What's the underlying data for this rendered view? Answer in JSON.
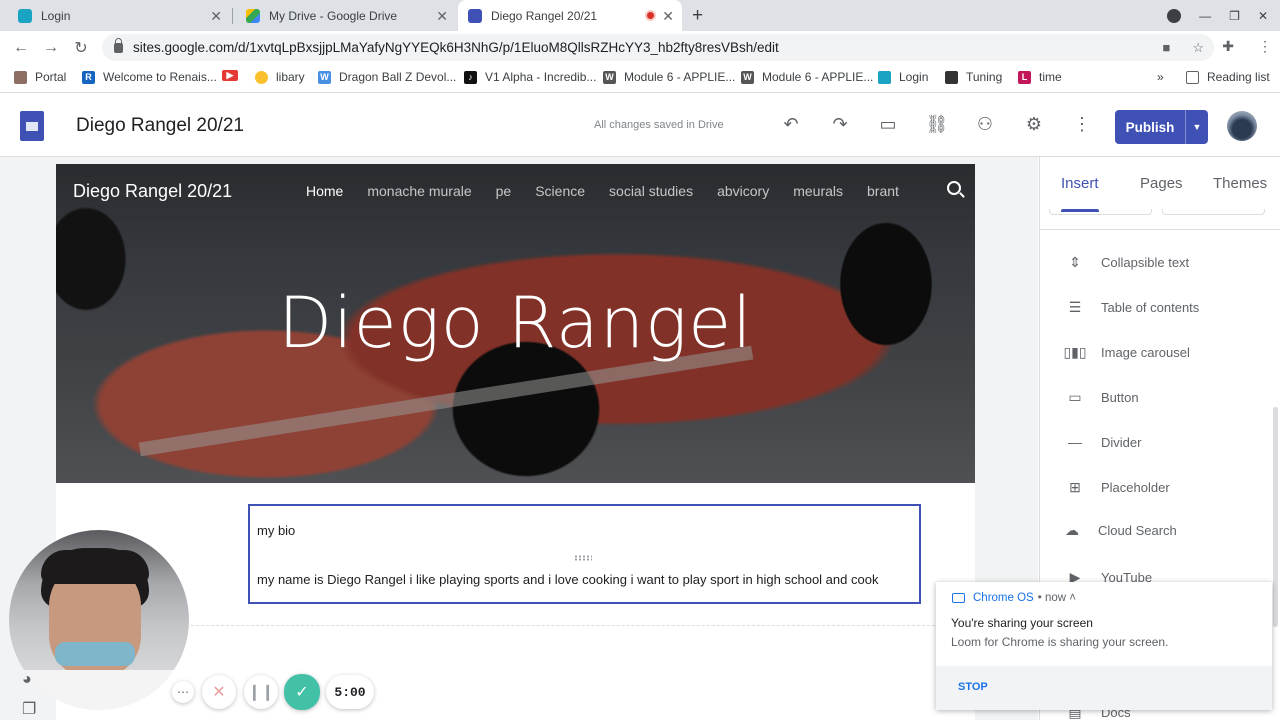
{
  "browser": {
    "tabs": [
      {
        "title": "Login",
        "color": "#1aa3c2"
      },
      {
        "title": "My Drive - Google Drive",
        "color": "#34a853"
      },
      {
        "title": "Diego Rangel 20/21",
        "color": "#3f51b5"
      }
    ],
    "url": "sites.google.com/d/1xvtqLpBxsjjpLMaYafyNgYYEQk6H3NhG/p/1EluoM8QllsRZHcYY3_hb2fty8resVBsh/edit",
    "bookmarks": [
      {
        "label": "Portal",
        "color": "#8d6e63"
      },
      {
        "label": "Welcome to Renais...",
        "color": "#1565c0"
      },
      {
        "label": "",
        "color": "#e53935"
      },
      {
        "label": "libary",
        "color": "#fbc02d"
      },
      {
        "label": "Dragon Ball Z Devol...",
        "color": "#4a90e2"
      },
      {
        "label": "V1 Alpha - Incredib...",
        "color": "#111111"
      },
      {
        "label": "Module 6 - APPLIE...",
        "color": "#555555"
      },
      {
        "label": "Module 6 - APPLIE...",
        "color": "#555555"
      },
      {
        "label": "Login",
        "color": "#1aa3c2"
      },
      {
        "label": "Tuning",
        "color": "#333333"
      },
      {
        "label": "time",
        "color": "#c2185b"
      }
    ],
    "more_bookmarks": "»",
    "reading_list": "Reading list"
  },
  "editor": {
    "title": "Diego Rangel 20/21",
    "save_status": "All changes saved in Drive",
    "publish_label": "Publish"
  },
  "site": {
    "name": "Diego Rangel 20/21",
    "nav": [
      "Home",
      "monache murale",
      "pe",
      "Science",
      "social studies",
      "abvicory",
      "meurals",
      "brant"
    ],
    "hero_title": "Diego Rangel",
    "textbox_heading": "my bio",
    "textbox_body": "my name is Diego Rangel i like playing  sports  and i love cooking i want to play sport in high school and cook"
  },
  "panel": {
    "tabs": [
      "Insert",
      "Pages",
      "Themes"
    ],
    "items": [
      {
        "label": "Collapsible text",
        "icon": "collapsible-text-icon"
      },
      {
        "label": "Table of contents",
        "icon": "table-of-contents-icon"
      },
      {
        "label": "Image carousel",
        "icon": "image-carousel-icon"
      },
      {
        "label": "Button",
        "icon": "button-icon"
      },
      {
        "label": "Divider",
        "icon": "divider-icon"
      },
      {
        "label": "Placeholder",
        "icon": "placeholder-icon"
      },
      {
        "label": "Cloud Search",
        "icon": "cloud-search-icon"
      },
      {
        "label": "YouTube",
        "icon": "youtube-icon"
      },
      {
        "label": "Docs",
        "icon": "docs-icon"
      }
    ]
  },
  "notification": {
    "source": "Chrome OS",
    "time": "• now ˄",
    "title": "You're sharing your screen",
    "message": "Loom for Chrome is sharing your screen.",
    "action": "STOP"
  },
  "loom": {
    "timer": "5:00"
  },
  "colors": {
    "accent": "#3f51b5",
    "loom_green": "#43c1a7",
    "link_blue": "#1a73e8"
  }
}
